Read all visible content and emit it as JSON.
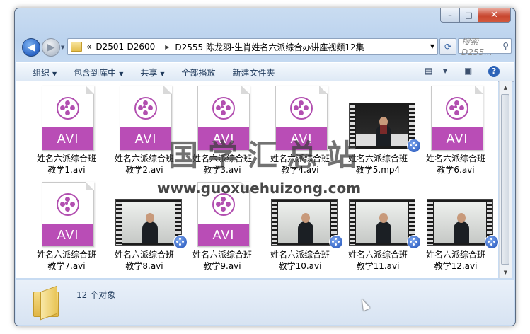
{
  "window": {
    "caption_buttons": {
      "minimize": "–",
      "maximize": "□",
      "close": "✕"
    }
  },
  "nav": {
    "address": {
      "overflow": "«",
      "segments": [
        "D2501-D2600",
        "D2555 陈龙羽-生肖姓名六派综合办讲座视频12集"
      ]
    },
    "search_placeholder": "搜索 D255..."
  },
  "toolbar": {
    "organize": "组织",
    "include_library": "包含到库中",
    "share": "共享",
    "play_all": "全部播放",
    "new_folder": "新建文件夹"
  },
  "files": [
    {
      "line1": "姓名六派综合班",
      "line2": "教学1.avi",
      "type": "avi"
    },
    {
      "line1": "姓名六派综合班",
      "line2": "教学2.avi",
      "type": "avi"
    },
    {
      "line1": "姓名六派综合班",
      "line2": "教学3.avi",
      "type": "avi"
    },
    {
      "line1": "姓名六派综合班",
      "line2": "教学4.avi",
      "type": "avi"
    },
    {
      "line1": "姓名六派综合班",
      "line2": "教学5.mp4",
      "type": "video"
    },
    {
      "line1": "姓名六派综合班",
      "line2": "教学6.avi",
      "type": "avi"
    },
    {
      "line1": "姓名六派综合班",
      "line2": "教学7.avi",
      "type": "avi"
    },
    {
      "line1": "姓名六派综合班",
      "line2": "教学8.avi",
      "type": "video"
    },
    {
      "line1": "姓名六派综合班",
      "line2": "教学9.avi",
      "type": "avi"
    },
    {
      "line1": "姓名六派综合班",
      "line2": "教学10.avi",
      "type": "video"
    },
    {
      "line1": "姓名六派综合班",
      "line2": "教学11.avi",
      "type": "video"
    },
    {
      "line1": "姓名六派综合班",
      "line2": "教学12.avi",
      "type": "video"
    }
  ],
  "file_type_label": "AVI",
  "watermark": {
    "text": "国学汇总站",
    "url": "www.guoxuehuizong.com"
  },
  "details": {
    "count": "12 个对象"
  }
}
